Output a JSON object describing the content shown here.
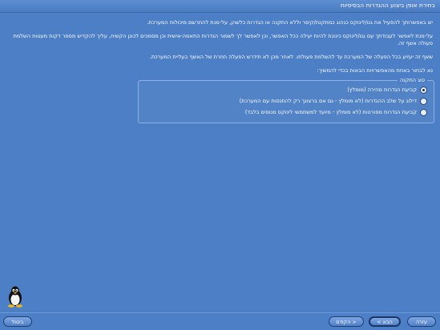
{
  "window": {
    "title": "בחירת אופן ביצוע ההגדרות הבסיסיות"
  },
  "body": {
    "para1": "יש באפשרותך להפעיל את גנו/לינוקס כנהוג כמתקנת/קיסר וללא התקנה או הגדרות כלשהן, על-מנת להתרשם מיכולות המערכת.",
    "para2": "על-מנת לאפשר לעבודתך עם גנו/לינוקס כינונת להיות יעילה ככל האפשר, וכן לאפשר לך לשמור הגדרות התאמה-אישית וכן מסמכים לכונן הקשיח, עליך להקדיש מספר דקות מעטות השלמת פעולה אשף זה.",
    "para3": "שאף זה יעזיע בכל הפעלה של המערכת עד להשלמת פעולתו. לאחר מכן לא תידרש הפעלה חוזרת של האשף בעליית המערכת.",
    "para4": "נא לבחור באחת מהאפשרויות הבאות בכדי להמשיך:"
  },
  "setup_type": {
    "legend": "סוג התקנה",
    "options": [
      {
        "label": "קביעת הגדרות מהירה (מומלץ)",
        "checked": true
      },
      {
        "label": "דילוג על שלב ההגדרות (לא מומלץ - גם אם ברצונך רק להתנסות עם המערכת)",
        "checked": false
      },
      {
        "label": "קביעת הגדרות מפורטות (לא מומלץ - מיועד למשתמשי לינוקס מנוסים בלבד)",
        "checked": false
      }
    ]
  },
  "buttons": {
    "cancel": "ביטול",
    "previous": "< הקודם",
    "next": "הבא >",
    "help": "עזרה"
  }
}
